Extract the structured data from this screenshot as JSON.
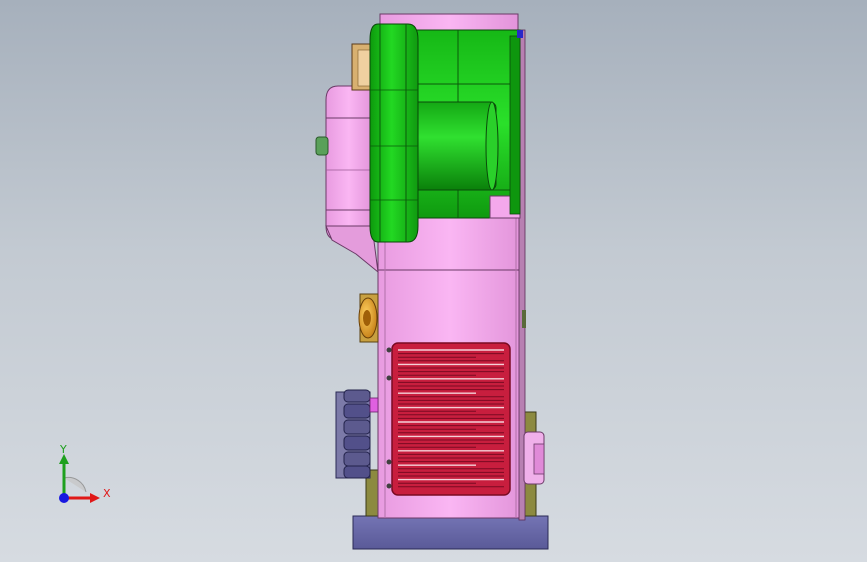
{
  "viewport": {
    "background_top": "#a6b0bc",
    "background_bottom": "#d6dbe1"
  },
  "model": {
    "colors": {
      "housing_pink": "#f7a9f0",
      "housing_pink_dark": "#d98ad2",
      "motor_green": "#18c418",
      "motor_green_dark": "#0c8a0c",
      "grille_red": "#c41e3a",
      "grille_frame": "#9a1a34",
      "base_blue": "#6a6aa8",
      "pulley_slate": "#5a5a8a",
      "knob_orange": "#f0a018",
      "olive": "#8a8a3a"
    },
    "parts": [
      "motor-housing",
      "motor-shaft-cylinder",
      "front-flywheel",
      "gearbox-housing",
      "main-cabinet",
      "vent-grille",
      "adjust-knob",
      "belt-pulley",
      "side-bearing",
      "base-plate"
    ]
  },
  "triad": {
    "x_label": "X",
    "y_label": "Y",
    "x_color": "#e01818",
    "y_color": "#1ea01e",
    "z_color": "#1818e0"
  }
}
